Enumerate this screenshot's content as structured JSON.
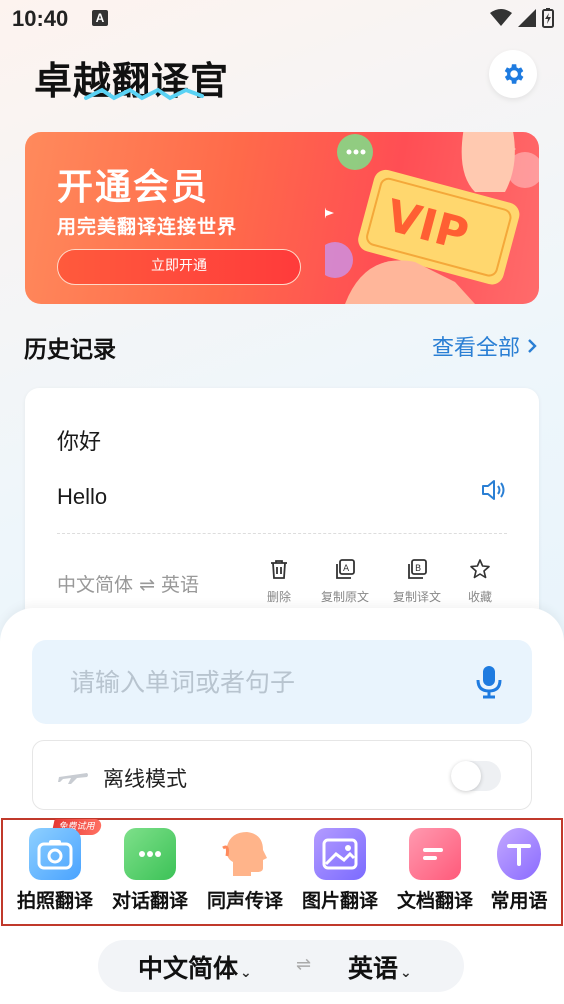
{
  "status": {
    "time": "10:40",
    "notif": "A"
  },
  "app_title": "卓越翻译官",
  "banner": {
    "title": "开通会员",
    "subtitle": "用完美翻译连接世界",
    "button": "立即开通",
    "badge": "VIP"
  },
  "history": {
    "title": "历史记录",
    "view_all": "查看全部",
    "item": {
      "source": "你好",
      "target": "Hello",
      "lang_from": "中文简体",
      "swap": "⇌",
      "lang_to": "英语",
      "actions": [
        "删除",
        "复制原文",
        "复制译文",
        "收藏"
      ]
    }
  },
  "input": {
    "placeholder": "请输入单词或者句子"
  },
  "offline": {
    "label": "离线模式",
    "enabled": false
  },
  "tools": {
    "free_badge": "免费试用",
    "items": [
      "拍照翻译",
      "对话翻译",
      "同声传译",
      "图片翻译",
      "文档翻译",
      "常用语"
    ]
  },
  "lang_bar": {
    "from": "中文简体",
    "swap": "⇌",
    "to": "英语"
  },
  "colors": {
    "accent": "#2a7fd4",
    "banner": "#ff5a4e",
    "highlight_border": "#c0392b"
  }
}
